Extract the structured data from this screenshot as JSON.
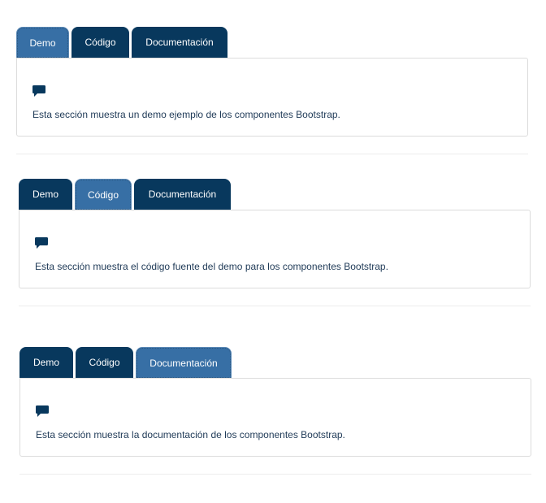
{
  "sections": [
    {
      "tabs": [
        {
          "label": "Demo",
          "active": true
        },
        {
          "label": "Código",
          "active": false
        },
        {
          "label": "Documentación",
          "active": false
        }
      ],
      "icon": "comment-icon",
      "text": "Esta sección muestra un demo ejemplo de los componentes Bootstrap."
    },
    {
      "tabs": [
        {
          "label": "Demo",
          "active": false
        },
        {
          "label": "Código",
          "active": true
        },
        {
          "label": "Documentación",
          "active": false
        }
      ],
      "icon": "comment-icon",
      "text": "Esta sección muestra el código fuente del demo para los componentes Bootstrap."
    },
    {
      "tabs": [
        {
          "label": "Demo",
          "active": false
        },
        {
          "label": "Código",
          "active": false
        },
        {
          "label": "Documentación",
          "active": true
        }
      ],
      "icon": "comment-icon",
      "text": "Esta sección muestra la documentación de los componentes Bootstrap."
    }
  ],
  "colors": {
    "tab_inactive": "#08385d",
    "tab_active": "#376fa5",
    "icon": "#08385d",
    "text": "#1f3a57"
  }
}
